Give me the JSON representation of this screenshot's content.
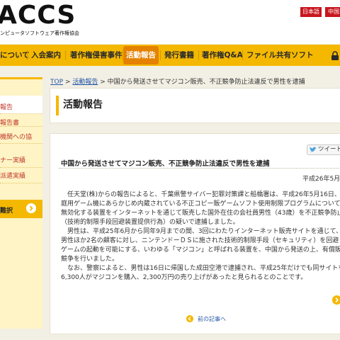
{
  "header": {
    "logo": "ACCS",
    "logo_sub": "ンピュータソフトウェア著作権協会",
    "lang_ja": "日本語",
    "lang_zh": "中国"
  },
  "nav": {
    "items": [
      "について",
      "入会案内",
      "著作権侵害事件",
      "活動報告",
      "発行書籍",
      "著作権Q&A",
      "ファイル共有ソフト"
    ]
  },
  "sidebar": {
    "items": [
      "報告",
      "報告書",
      "機関への協",
      "ナー実績",
      "派遣実績"
    ],
    "search_label": "難択"
  },
  "breadcrumb": {
    "top": "TOP",
    "sep1": ">",
    "section": "活動報告",
    "sep2": ">",
    "current": "中国から発送させてマジコン販売、不正競争防止法違反で男性を逮捕"
  },
  "page_title": "活動報告",
  "article": {
    "tweet_label": "ツイート",
    "title": "中国から発送させてマジコン販売、不正競争防止法違反で男性を逮捕",
    "date": "平成26年5月",
    "lines": [
      "　任天堂(株)からの報告によると、千葉県警サイバー犯罪対策課と船橋署は、平成26年5月16日、家",
      "庭用ゲーム機にあらかじめ内蔵されている不正コピー販ゲームソフト使用制限プログラムについて",
      "無効化する装置をインターネットを通じて販売した国外在住の会社員男性（43歳）を不正競争防止",
      "（技術的制限手段回避装置提供行為）の疑いで逮捕しました。",
      "　男性は、平成25年6月から同年9月までの間、3回にわたりインターネット販売サイトを通じて、",
      "男性ほか2名の顧客に対し、ニンテンドーＤＳに施された技術的制限手段（セキュリティ）を回避し",
      "ゲームの起動を可能にする、いわゆる「マジコン」と呼ばれる装置を、中国から発送の上、有償販",
      "競争を行いました。",
      "　なお、警察によると、男性は16日に帰国した成田空港で逮捕され、平成25年だけでも同サイトを",
      "6,300人がマジコンを購入、2,300万円の売り上げがあったと見られるとのことです。"
    ],
    "prev_link": "前の記事へ"
  },
  "colors": {
    "accent": "#f4b800",
    "nav_active": "#e48200",
    "lang_button": "#c8161e",
    "link": "#2a5aa7"
  },
  "icons": {
    "lock": "lock-icon",
    "search_arrow": "arrow-right-circle-icon",
    "tweet": "twitter-bird-icon"
  }
}
